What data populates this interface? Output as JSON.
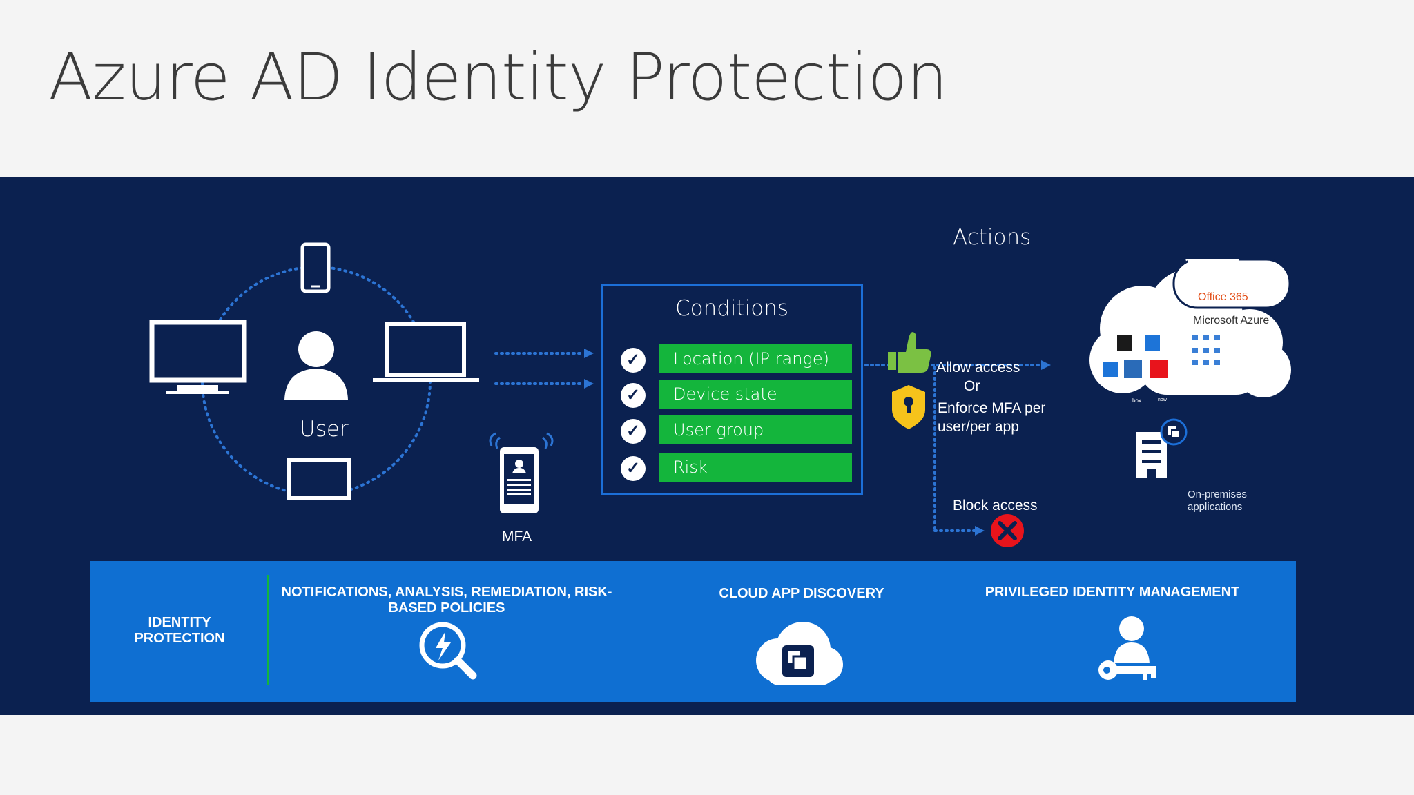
{
  "title": "Azure AD Identity Protection",
  "user": {
    "label": "User"
  },
  "mfa": {
    "label": "MFA"
  },
  "conditions": {
    "title": "Conditions",
    "items": [
      "Location (IP range)",
      "Device state",
      "User group",
      "Risk"
    ]
  },
  "actions": {
    "title": "Actions",
    "allow": "Allow access",
    "or": "Or",
    "enforce": "Enforce MFA per user/per app",
    "block": "Block access"
  },
  "cloud": {
    "office365": "Office 365",
    "azure": "Microsoft Azure",
    "app_tiles": [
      "box",
      "now"
    ]
  },
  "onprem": {
    "label": "On-premises applications"
  },
  "band": {
    "identity_protection": "IDENTITY PROTECTION",
    "notifications": "NOTIFICATIONS, ANALYSIS, REMEDIATION, RISK-BASED POLICIES",
    "cloud_app_discovery": "CLOUD APP DISCOVERY",
    "pim": "PRIVILEGED IDENTITY MANAGEMENT"
  },
  "colors": {
    "background": "#0b2150",
    "accent_green": "#14b53c",
    "band_blue": "#0f6fd2",
    "box_border": "#1c6fd8",
    "block_red": "#e8141c",
    "shield_yellow": "#f6c31b"
  }
}
